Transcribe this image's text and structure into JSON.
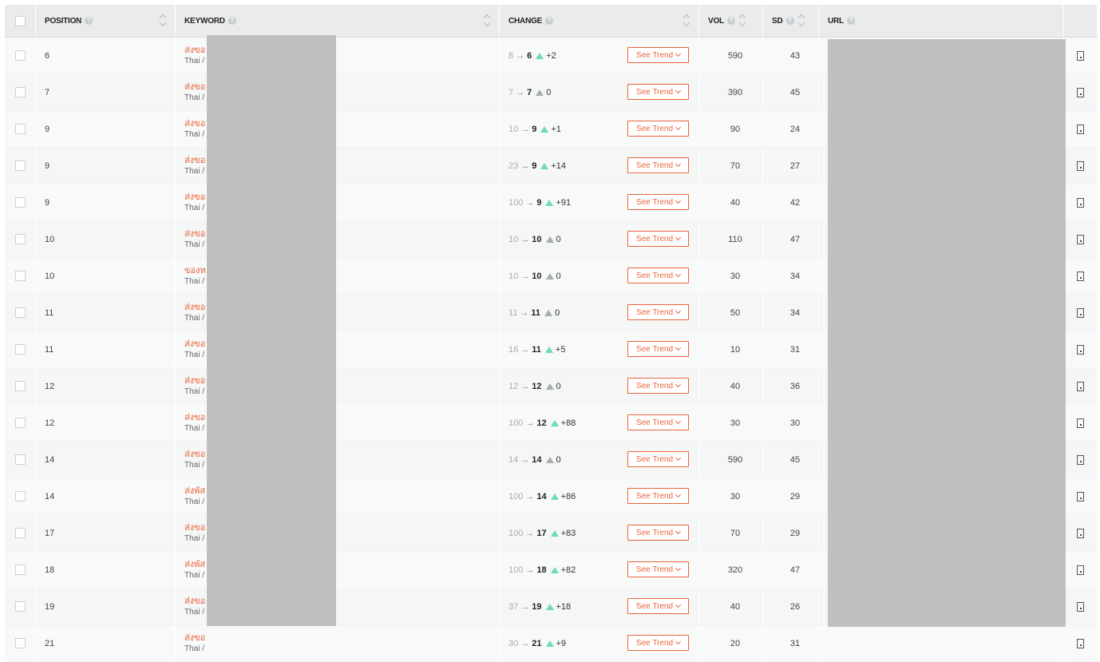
{
  "header": {
    "position": "POSITION",
    "keyword": "KEYWORD",
    "change": "CHANGE",
    "vol": "VOL",
    "sd": "SD",
    "url": "URL",
    "help_glyph": "?"
  },
  "trend_label": "See Trend",
  "arrow_glyph": "→",
  "rows": [
    {
      "position": "6",
      "keyword": "ส่งขอ",
      "lang": "Thai / ",
      "prev": "8",
      "cur": "6",
      "dir": "up",
      "delta": "+2",
      "vol": "590",
      "sd": "43"
    },
    {
      "position": "7",
      "keyword": "ส่งขอ",
      "lang": "Thai / ",
      "prev": "7",
      "cur": "7",
      "dir": "flat",
      "delta": "0",
      "vol": "390",
      "sd": "45"
    },
    {
      "position": "9",
      "keyword": "ส่งขอ",
      "lang": "Thai / ",
      "prev": "10",
      "cur": "9",
      "dir": "up",
      "delta": "+1",
      "vol": "90",
      "sd": "24"
    },
    {
      "position": "9",
      "keyword": "ส่งขอ",
      "lang": "Thai / ",
      "prev": "23",
      "cur": "9",
      "dir": "up",
      "delta": "+14",
      "vol": "70",
      "sd": "27"
    },
    {
      "position": "9",
      "keyword": "ส่งขอ",
      "lang": "Thai / ",
      "prev": "100",
      "cur": "9",
      "dir": "up",
      "delta": "+91",
      "vol": "40",
      "sd": "42"
    },
    {
      "position": "10",
      "keyword": "ส่งขอ",
      "lang": "Thai / ",
      "prev": "10",
      "cur": "10",
      "dir": "flat",
      "delta": "0",
      "vol": "110",
      "sd": "47"
    },
    {
      "position": "10",
      "keyword": "ของห",
      "lang": "Thai / ",
      "prev": "10",
      "cur": "10",
      "dir": "flat",
      "delta": "0",
      "vol": "30",
      "sd": "34"
    },
    {
      "position": "11",
      "keyword": "ส่งขอ",
      "lang": "Thai / ",
      "prev": "11",
      "cur": "11",
      "dir": "flat",
      "delta": "0",
      "vol": "50",
      "sd": "34"
    },
    {
      "position": "11",
      "keyword": "ส่งขอ",
      "lang": "Thai / ",
      "prev": "16",
      "cur": "11",
      "dir": "up",
      "delta": "+5",
      "vol": "10",
      "sd": "31"
    },
    {
      "position": "12",
      "keyword": "ส่งขอ",
      "lang": "Thai / ",
      "prev": "12",
      "cur": "12",
      "dir": "flat",
      "delta": "0",
      "vol": "40",
      "sd": "36"
    },
    {
      "position": "12",
      "keyword": "ส่งขอ",
      "lang": "Thai / ",
      "prev": "100",
      "cur": "12",
      "dir": "up",
      "delta": "+88",
      "vol": "30",
      "sd": "30"
    },
    {
      "position": "14",
      "keyword": "ส่งขอ",
      "lang": "Thai / ",
      "prev": "14",
      "cur": "14",
      "dir": "flat",
      "delta": "0",
      "vol": "590",
      "sd": "45"
    },
    {
      "position": "14",
      "keyword": "ส่งพัส",
      "lang": "Thai / ",
      "prev": "100",
      "cur": "14",
      "dir": "up",
      "delta": "+86",
      "vol": "30",
      "sd": "29"
    },
    {
      "position": "17",
      "keyword": "ส่งขอ",
      "lang": "Thai / ",
      "prev": "100",
      "cur": "17",
      "dir": "up",
      "delta": "+83",
      "vol": "70",
      "sd": "29"
    },
    {
      "position": "18",
      "keyword": "ส่งพัส",
      "lang": "Thai / ",
      "prev": "100",
      "cur": "18",
      "dir": "up",
      "delta": "+82",
      "vol": "320",
      "sd": "47"
    },
    {
      "position": "19",
      "keyword": "ส่งขอ",
      "lang": "Thai / ",
      "prev": "37",
      "cur": "19",
      "dir": "up",
      "delta": "+18",
      "vol": "40",
      "sd": "26"
    },
    {
      "position": "21",
      "keyword": "ส่งขอ",
      "lang": "Thai / ",
      "prev": "30",
      "cur": "21",
      "dir": "up",
      "delta": "+9",
      "vol": "20",
      "sd": "31"
    }
  ]
}
